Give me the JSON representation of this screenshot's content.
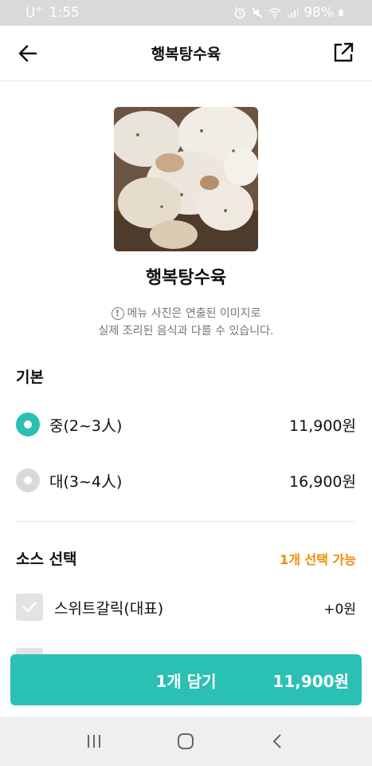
{
  "status_bar": {
    "carrier": "U",
    "carrier_sup": "+",
    "time": "1:55",
    "battery": "98%"
  },
  "header": {
    "title": "행복탕수육"
  },
  "product": {
    "name": "행복탕수육",
    "notice_line1": "메뉴 사진은 연출된 이미지로",
    "notice_line2": "실제 조리된 음식과 다를 수 있습니다.",
    "notice_icon": "!"
  },
  "basic": {
    "title": "기본",
    "options": [
      {
        "label": "중(2~3人)",
        "price": "11,900원",
        "selected": true
      },
      {
        "label": "대(3~4人)",
        "price": "16,900원",
        "selected": false
      }
    ]
  },
  "sauce": {
    "title": "소스 선택",
    "hint": "1개 선택 가능",
    "options": [
      {
        "label": "스위트갈릭(대표)",
        "price": "+0원"
      }
    ]
  },
  "cta": {
    "label": "1개 담기",
    "price": "11,900원"
  },
  "colors": {
    "accent": "#2bc0b4",
    "hint": "#f28b00"
  }
}
